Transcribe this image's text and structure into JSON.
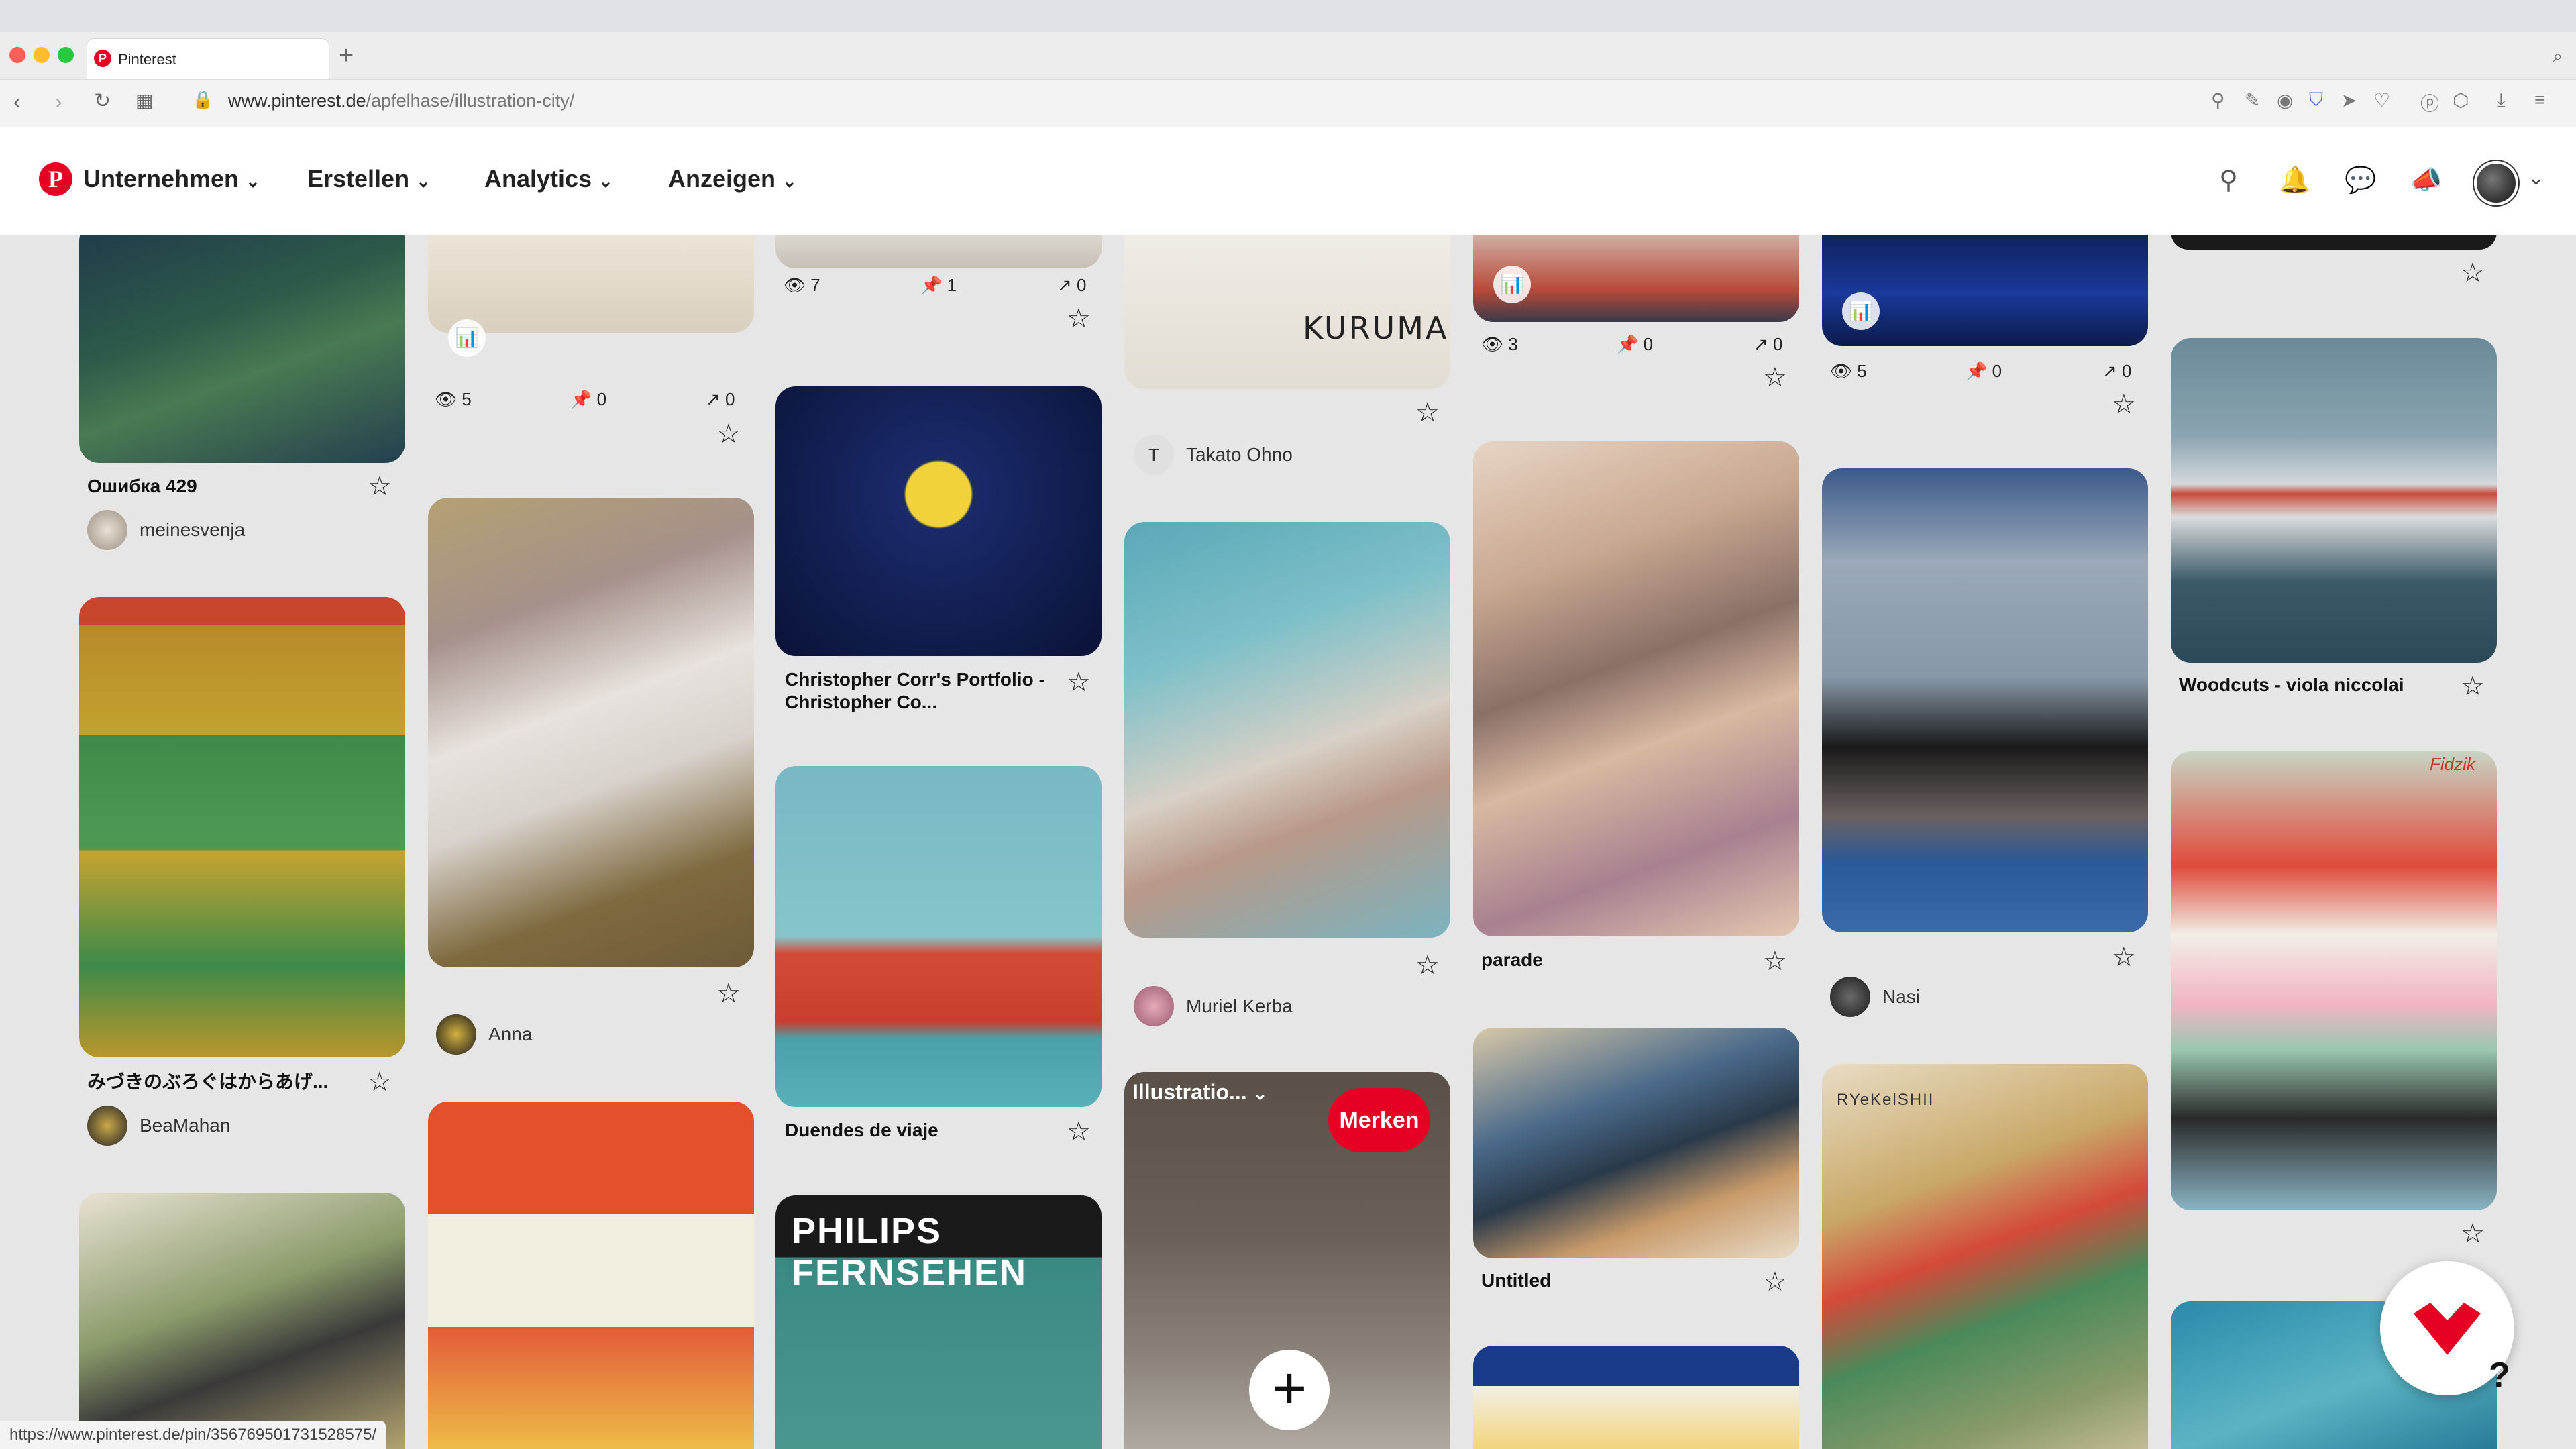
{
  "browser": {
    "tab_title": "Pinterest",
    "url_domain": "www.pinterest.de",
    "url_path": "/apfelhase/illustration-city/",
    "status_url": "https://www.pinterest.de/pin/356769501731528575/"
  },
  "header": {
    "logo": "P",
    "menu": [
      {
        "label": "Unternehmen"
      },
      {
        "label": "Erstellen"
      },
      {
        "label": "Analytics"
      },
      {
        "label": "Anzeigen"
      }
    ],
    "icons": [
      "search-icon",
      "bell-icon",
      "chat-icon",
      "megaphone-icon",
      "avatar",
      "chevron-down-icon"
    ]
  },
  "pins": {
    "col1": [
      {
        "title": "Ошибка 429",
        "user": "meinesvenja"
      },
      {
        "title": "みづきのぶろぐはからあげ...",
        "user": "BeaMahan"
      }
    ],
    "col2": [
      {
        "views": "5",
        "saves": "0",
        "clicks": "0"
      },
      {
        "user": "Anna"
      }
    ],
    "col3": [
      {
        "views": "7",
        "saves": "1",
        "clicks": "0"
      },
      {
        "title": "Christopher Corr's Portfolio - Christopher Co..."
      },
      {
        "title": "Duendes de viaje"
      },
      {
        "title": "PHILIPS FERNSEHEN"
      }
    ],
    "col4": [
      {
        "caption": "KURUMA",
        "user": "Takato Ohno",
        "initial": "T"
      },
      {
        "user": "Muriel Kerba"
      },
      {
        "board": "Illustratio...",
        "merken": "Merken"
      }
    ],
    "col5": [
      {
        "views": "3",
        "saves": "0",
        "clicks": "0"
      },
      {
        "title": "parade"
      },
      {
        "title": "Untitled"
      }
    ],
    "col6": [
      {
        "views": "5",
        "saves": "0",
        "clicks": "0"
      },
      {
        "user": "Nasi"
      },
      {
        "caption": "RYeKelSHII"
      }
    ],
    "col7": [
      {
        "title": "Woodcuts - viola niccolai"
      },
      {
        "caption": "Fidzik"
      }
    ]
  },
  "fab_help": "?"
}
